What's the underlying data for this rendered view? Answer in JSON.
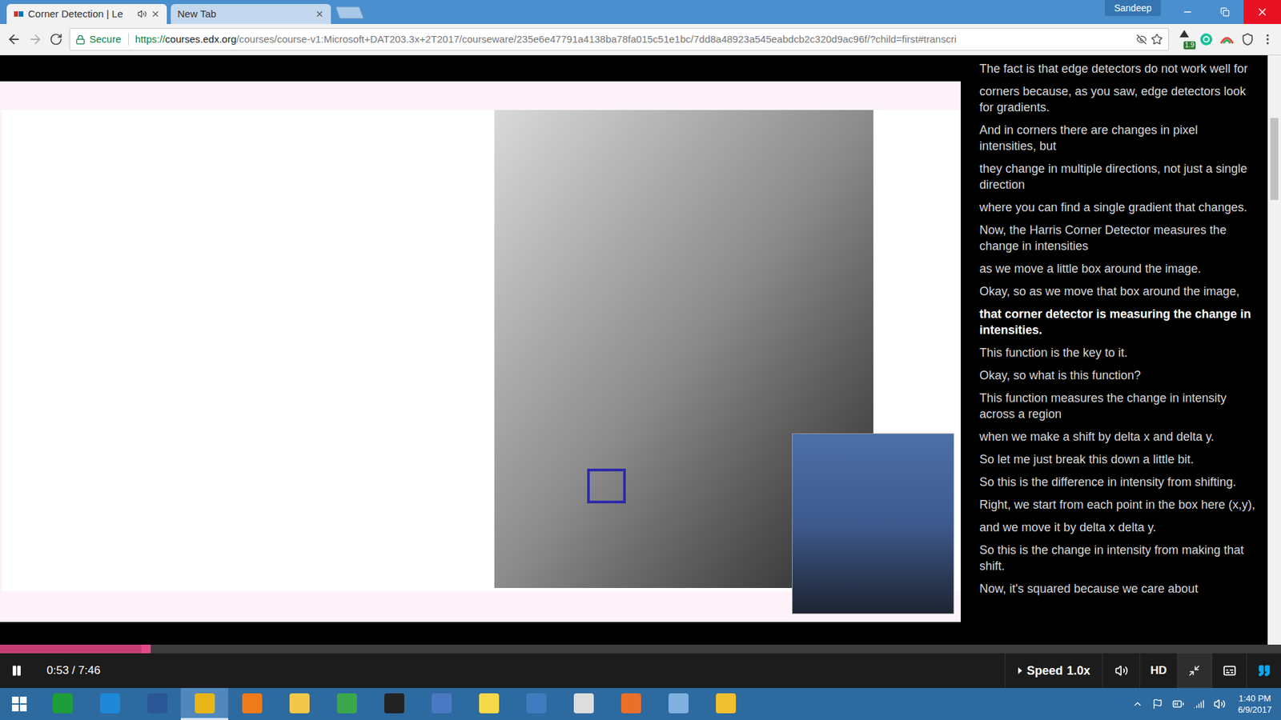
{
  "browser": {
    "tabs": [
      {
        "label": "Corner Detection | Le",
        "selected": true,
        "audio": true
      },
      {
        "label": "New Tab",
        "selected": false,
        "audio": false
      }
    ],
    "profile": "Sandeep",
    "address": {
      "secure_label": "Secure",
      "scheme": "https://",
      "host": "courses.edx.org",
      "path": "/courses/course-v1:Microsoft+DAT203.3x+2T2017/courseware/235e6e47791a4138ba78fa015c51e1bc/7dd8a48923a545eabdcb2c320d9ac96f/?child=first#transcri",
      "bookmarked": false
    },
    "extension_badge": "1.9"
  },
  "player": {
    "time": "0:53 / 7:46",
    "level": 0.114,
    "playing": true,
    "speed_label": "Speed",
    "speed": "1.0x",
    "quality": "HD",
    "fullscreen": true,
    "captions": false,
    "transcript": true
  },
  "transcript": {
    "lines": [
      {
        "text": "The fact is that edge detectors do not work well for",
        "selected": false
      },
      {
        "text": "corners because, as you saw, edge detectors look for gradients.",
        "selected": false
      },
      {
        "text": "And in corners there are changes in pixel intensities, but",
        "selected": false
      },
      {
        "text": "they change in multiple directions, not just a single direction",
        "selected": false
      },
      {
        "text": "where you can find a single gradient that changes.",
        "selected": false
      },
      {
        "text": "Now, the Harris Corner Detector measures the change in intensities",
        "selected": false
      },
      {
        "text": "as we move a little box around the image.",
        "selected": false
      },
      {
        "text": "Okay, so as we move that box around the image,",
        "selected": false
      },
      {
        "text": "that corner detector is measuring the change in intensities.",
        "selected": true
      },
      {
        "text": "This function is the key to it.",
        "selected": false
      },
      {
        "text": "Okay, so what is this function?",
        "selected": false
      },
      {
        "text": "This function measures the change in intensity across a region",
        "selected": false
      },
      {
        "text": "when we make a shift by delta x and delta y.",
        "selected": false
      },
      {
        "text": "So let me just break this down a little bit.",
        "selected": false
      },
      {
        "text": "So this is the difference in intensity from shifting.",
        "selected": false
      },
      {
        "text": "Right, we start from each point in the box here (x,y),",
        "selected": false
      },
      {
        "text": "and we move it by delta x delta y.",
        "selected": false
      },
      {
        "text": "So this is the change in intensity from making that shift.",
        "selected": false
      },
      {
        "text": "Now, it's squared because we care about",
        "selected": false
      }
    ]
  },
  "taskbar": {
    "apps": [
      {
        "active": false,
        "color": "#1e9e3a"
      },
      {
        "active": false,
        "color": "#1e88d8"
      },
      {
        "active": false,
        "color": "#2b5797"
      },
      {
        "active": true,
        "color": "#e8b518"
      },
      {
        "active": false,
        "color": "#f07a1a"
      },
      {
        "active": false,
        "color": "#f2c84b"
      },
      {
        "active": false,
        "color": "#3aa84a"
      },
      {
        "active": false,
        "color": "#222222"
      },
      {
        "active": false,
        "color": "#4a78c2"
      },
      {
        "active": false,
        "color": "#f5d94a"
      },
      {
        "active": false,
        "color": "#3f7cbf"
      },
      {
        "active": false,
        "color": "#dddddd"
      },
      {
        "active": false,
        "color": "#e9702a"
      },
      {
        "active": false,
        "color": "#7fb0e0"
      },
      {
        "active": false,
        "color": "#f0c030"
      }
    ],
    "time": "1:40 PM",
    "date": "6/9/2017"
  }
}
